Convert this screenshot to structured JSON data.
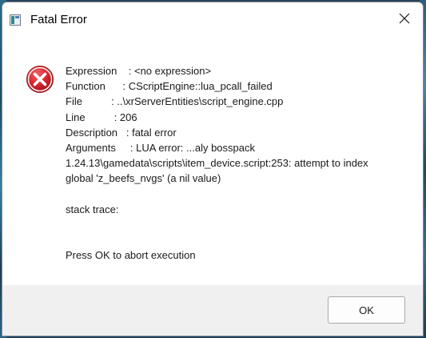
{
  "window": {
    "title": "Fatal Error",
    "app_icon": "console-window-icon",
    "close_icon": "close-icon"
  },
  "message": {
    "icon": "error-x-icon",
    "lines": [
      "Expression    : <no expression>",
      "Function      : CScriptEngine::lua_pcall_failed",
      "File          : ..\\xrServerEntities\\script_engine.cpp",
      "Line          : 206",
      "Description   : fatal error",
      "Arguments     : LUA error: ...aly bosspack",
      "1.24.13\\gamedata\\scripts\\item_device.script:253: attempt to index",
      "global 'z_beefs_nvgs' (a nil value)"
    ],
    "stack_trace": "stack trace:",
    "prompt": "Press OK to abort execution"
  },
  "buttons": {
    "ok_label": "OK"
  },
  "colors": {
    "error_red": "#d8262f",
    "desktop": "#24445e",
    "footer": "#f0f0f0"
  }
}
